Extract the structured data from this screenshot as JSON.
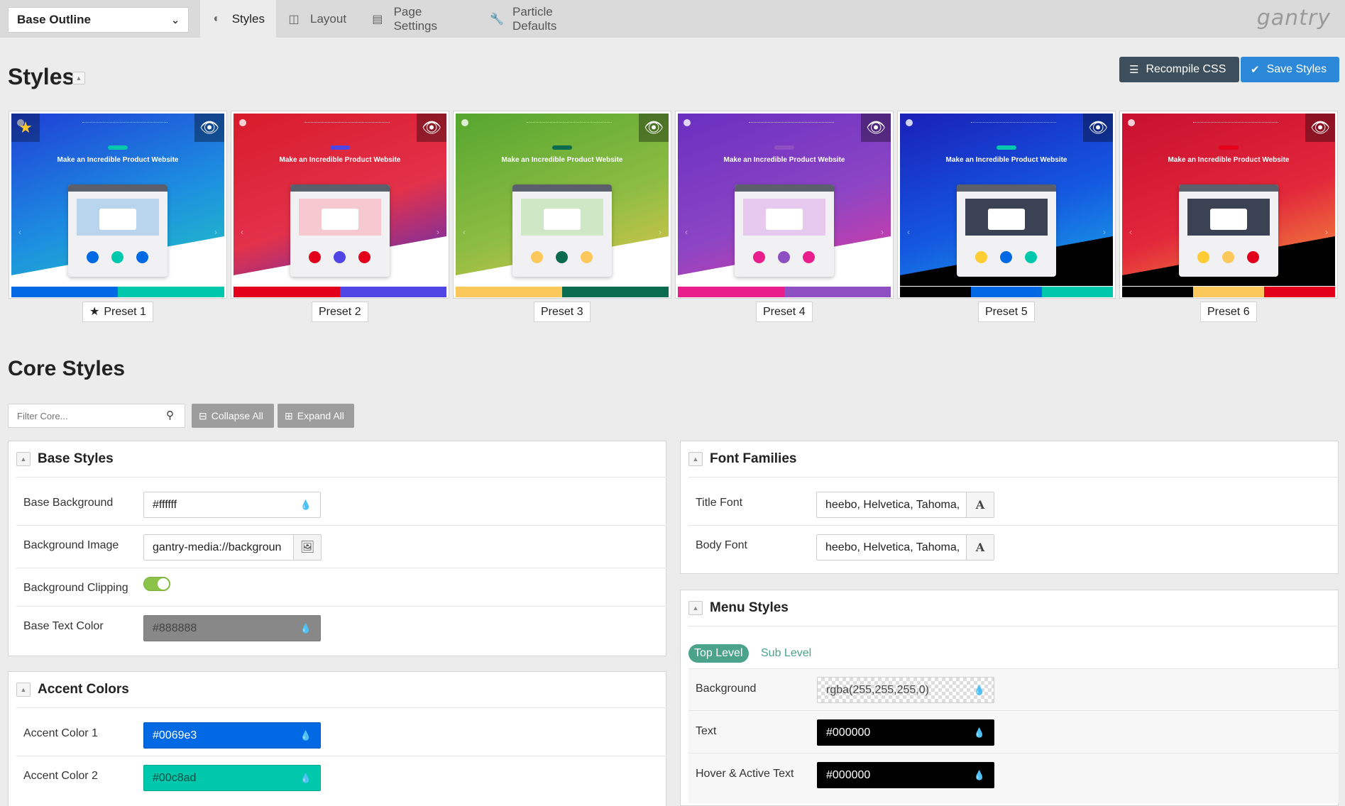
{
  "topbar": {
    "outline_select": "Base Outline",
    "tabs": [
      {
        "label": "Styles",
        "icon": "half-circle-icon"
      },
      {
        "label": "Layout",
        "icon": "layout-icon"
      },
      {
        "label": "Page Settings",
        "icon": "page-settings-icon"
      },
      {
        "label": "Particle Defaults",
        "icon": "wrench-icon"
      }
    ],
    "active_tab": "Styles",
    "brand": "gantry"
  },
  "header": {
    "title": "Styles",
    "recompile_label": "Recompile CSS",
    "save_label": "Save Styles"
  },
  "presets": [
    {
      "label": "Preset 1",
      "active": true,
      "headline": "Make an Incredible Product Website",
      "colors": [
        "#0069e3",
        "#00c8ad"
      ]
    },
    {
      "label": "Preset 2",
      "active": false,
      "headline": "Make an Incredible Product Website",
      "colors": [
        "#e3001b",
        "#4f46e5"
      ]
    },
    {
      "label": "Preset 3",
      "active": false,
      "headline": "Make an Incredible Product Website",
      "colors": [
        "#fcc85b",
        "#0a6c4e"
      ]
    },
    {
      "label": "Preset 4",
      "active": false,
      "headline": "Make an Incredible Product Website",
      "colors": [
        "#e91e8c",
        "#8e4fc2"
      ]
    },
    {
      "label": "Preset 5",
      "active": false,
      "headline": "Make an Incredible Product Website",
      "colors": [
        "#000000",
        "#0069e3",
        "#00c8ad"
      ]
    },
    {
      "label": "Preset 6",
      "active": false,
      "headline": "Make an Incredible Product Website",
      "colors": [
        "#000000",
        "#fcc85b",
        "#e3001b"
      ]
    }
  ],
  "core": {
    "title": "Core Styles",
    "filter_placeholder": "Filter Core...",
    "collapse_all": "Collapse All",
    "expand_all": "Expand All"
  },
  "base_styles": {
    "title": "Base Styles",
    "fields": [
      {
        "label": "Base Background",
        "value": "#ffffff"
      },
      {
        "label": "Background Image",
        "value": "gantry-media://backgroun"
      },
      {
        "label": "Background Clipping",
        "value": "on"
      },
      {
        "label": "Base Text Color",
        "value": "#888888"
      }
    ]
  },
  "accent_colors": {
    "title": "Accent Colors",
    "fields": [
      {
        "label": "Accent Color 1",
        "value": "#0069e3"
      },
      {
        "label": "Accent Color 2",
        "value": "#00c8ad"
      }
    ]
  },
  "font_families": {
    "title": "Font Families",
    "fields": [
      {
        "label": "Title Font",
        "value": "heebo, Helvetica, Tahoma,"
      },
      {
        "label": "Body Font",
        "value": "heebo, Helvetica, Tahoma,"
      }
    ]
  },
  "menu_styles": {
    "title": "Menu Styles",
    "tabs": [
      "Top Level",
      "Sub Level"
    ],
    "fields": [
      {
        "label": "Background",
        "value": "rgba(255,255,255,0)"
      },
      {
        "label": "Text",
        "value": "#000000"
      },
      {
        "label": "Hover & Active Text",
        "value": "#000000"
      }
    ]
  },
  "colors": {
    "accent": "#0069e3",
    "accent2": "#00c8ad",
    "save_button": "#2c88d9",
    "recompile_button": "#3d4f5c",
    "menu_tab_active": "#4aa38a"
  }
}
